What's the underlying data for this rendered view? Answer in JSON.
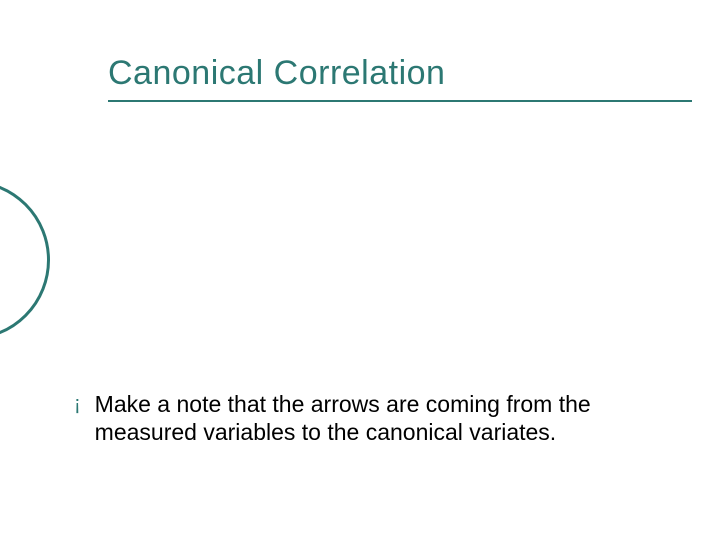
{
  "slide": {
    "title": "Canonical Correlation",
    "bullets": [
      {
        "marker": "¡",
        "text": "Make a note that the arrows are coming from the measured variables to the canonical variates."
      }
    ]
  }
}
